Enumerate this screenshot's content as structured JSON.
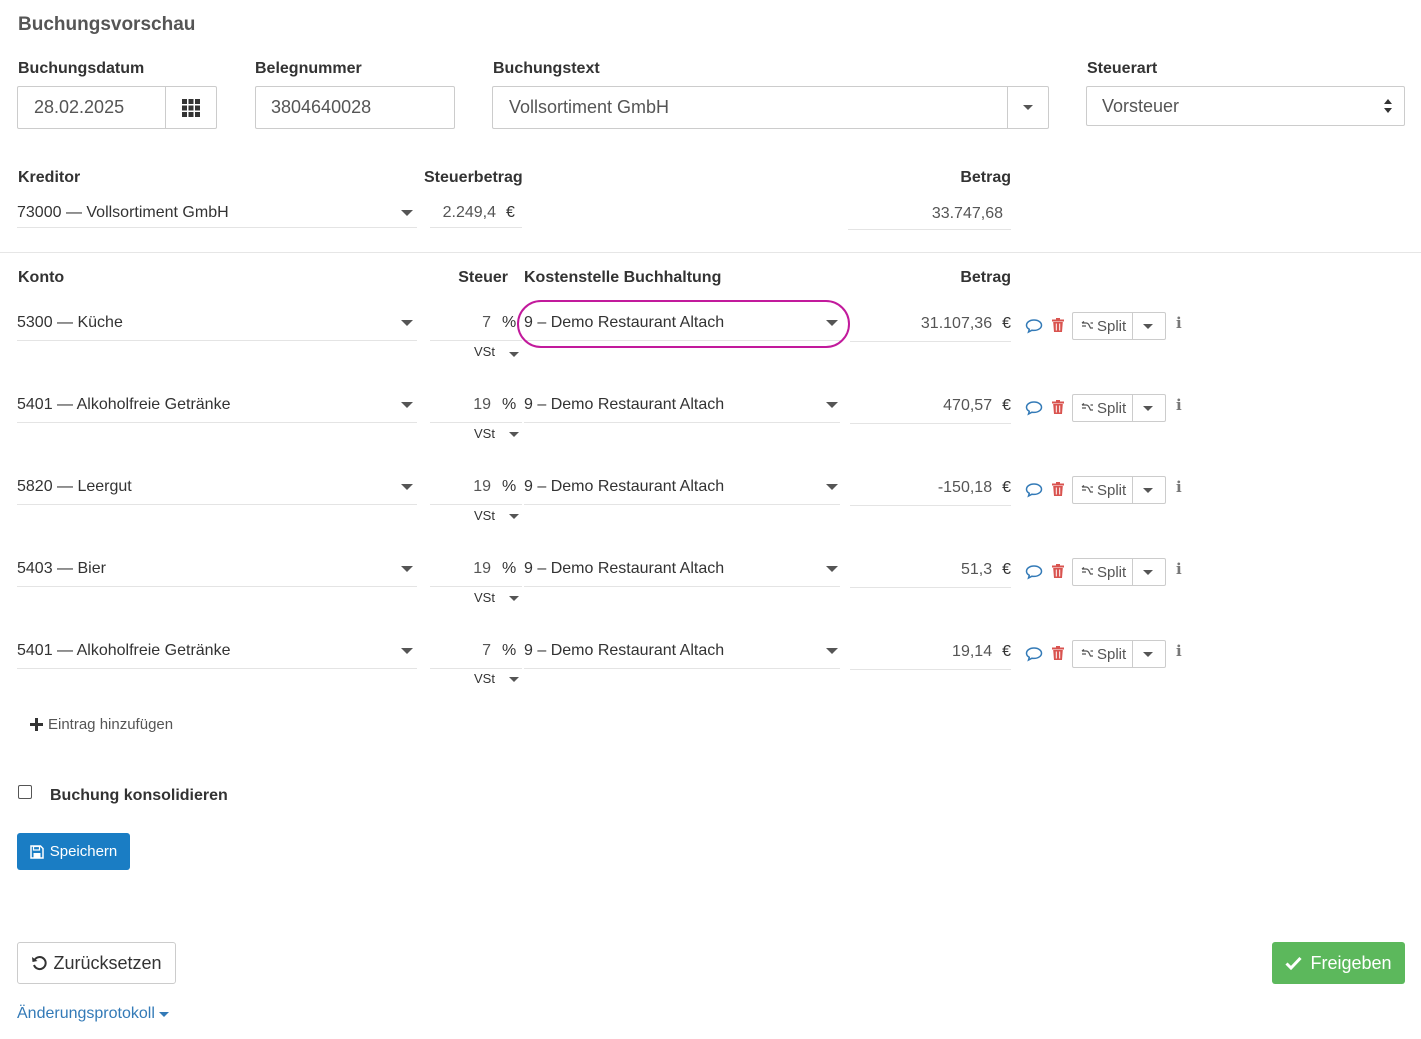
{
  "header": {
    "title": "Buchungsvorschau"
  },
  "fields": {
    "buchungsdatum": {
      "label": "Buchungsdatum",
      "value": "28.02.2025"
    },
    "belegnummer": {
      "label": "Belegnummer",
      "value": "3804640028"
    },
    "buchungstext": {
      "label": "Buchungstext",
      "value": "Vollsortiment GmbH"
    },
    "steuerart": {
      "label": "Steuerart",
      "value": "Vorsteuer"
    },
    "kreditor": {
      "label": "Kreditor",
      "value": "73000 — Vollsortiment GmbH"
    },
    "steuerbetrag": {
      "label": "Steuerbetrag",
      "value": "2.249,4",
      "currency": "€"
    },
    "betrag": {
      "label": "Betrag",
      "value": "33.747,68"
    }
  },
  "table": {
    "headers": {
      "konto": "Konto",
      "steuer": "Steuer",
      "kostenstelle": "Kostenstelle Buchhaltung",
      "betrag": "Betrag"
    },
    "rows": [
      {
        "konto": "5300 — Küche",
        "steuer": "7",
        "pct": "%",
        "vst": "VSt",
        "kostenstelle": "9 – Demo Restaurant Altach",
        "betrag": "31.107,36",
        "currency": "€",
        "split": "Split"
      },
      {
        "konto": "5401 — Alkoholfreie Getränke",
        "steuer": "19",
        "pct": "%",
        "vst": "VSt",
        "kostenstelle": "9 – Demo Restaurant Altach",
        "betrag": "470,57",
        "currency": "€",
        "split": "Split"
      },
      {
        "konto": "5820 — Leergut",
        "steuer": "19",
        "pct": "%",
        "vst": "VSt",
        "kostenstelle": "9 – Demo Restaurant Altach",
        "betrag": "-150,18",
        "currency": "€",
        "split": "Split"
      },
      {
        "konto": "5403 — Bier",
        "steuer": "19",
        "pct": "%",
        "vst": "VSt",
        "kostenstelle": "9 – Demo Restaurant Altach",
        "betrag": "51,3",
        "currency": "€",
        "split": "Split"
      },
      {
        "konto": "5401 — Alkoholfreie Getränke",
        "steuer": "7",
        "pct": "%",
        "vst": "VSt",
        "kostenstelle": "9 – Demo Restaurant Altach",
        "betrag": "19,14",
        "currency": "€",
        "split": "Split"
      }
    ]
  },
  "actions": {
    "add_entry": "Eintrag hinzufügen",
    "consolidate": "Buchung konsolidieren",
    "save": "Speichern",
    "reset": "Zurücksetzen",
    "release": "Freigeben",
    "changelog": "Änderungsprotokoll"
  },
  "colors": {
    "primary": "#1a7dc4",
    "success": "#5cb85c",
    "danger": "#d9534f",
    "highlight": "#c21a9c"
  }
}
